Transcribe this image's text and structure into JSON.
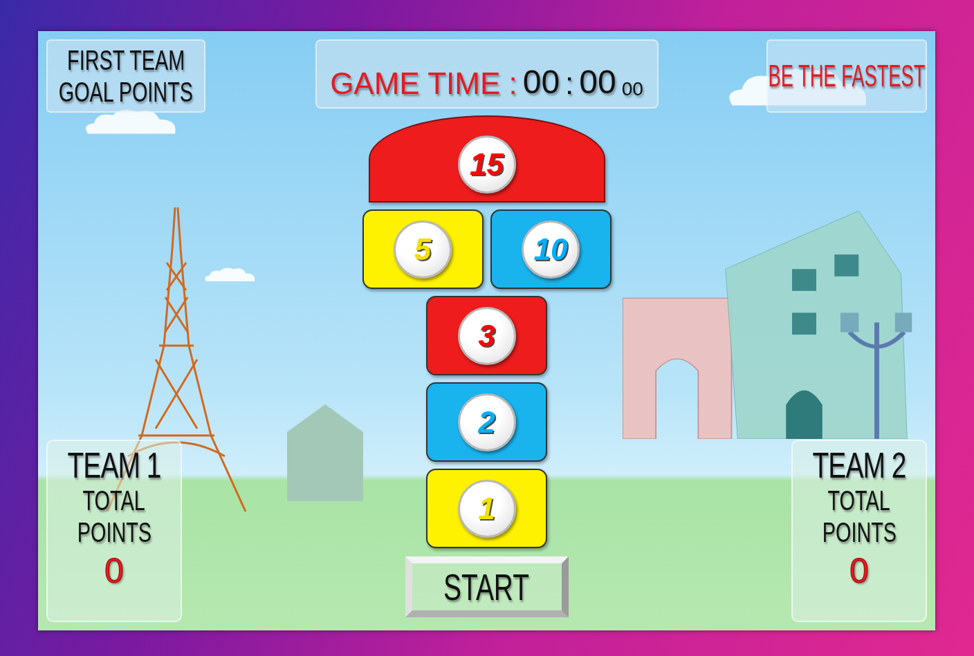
{
  "goal_points_box": {
    "lines": [
      "FIRST TEAM",
      "GOAL POINTS"
    ]
  },
  "game_time": {
    "label": "GAME TIME :",
    "minutes": "00",
    "separator": ":",
    "seconds": "00",
    "hundredths": "00"
  },
  "slogan": "BE THE FASTEST",
  "hopscotch": [
    [
      {
        "kind": "arch",
        "value": "15",
        "color": "#ee1c1c"
      }
    ],
    [
      {
        "kind": "box",
        "value": "5",
        "color": "#fff200"
      },
      {
        "kind": "box",
        "value": "10",
        "color": "#19b4ee"
      }
    ],
    [
      {
        "kind": "box",
        "value": "3",
        "color": "#ee1c1c"
      }
    ],
    [
      {
        "kind": "box",
        "value": "2",
        "color": "#19b4ee"
      }
    ],
    [
      {
        "kind": "box",
        "value": "1",
        "color": "#fff200"
      }
    ]
  ],
  "teams": [
    {
      "name": "TEAM 1",
      "label_lines": [
        "TOTAL",
        "POINTS"
      ],
      "score": "0"
    },
    {
      "name": "TEAM 2",
      "label_lines": [
        "TOTAL",
        "POINTS"
      ],
      "score": "0"
    }
  ],
  "start_button": "START"
}
